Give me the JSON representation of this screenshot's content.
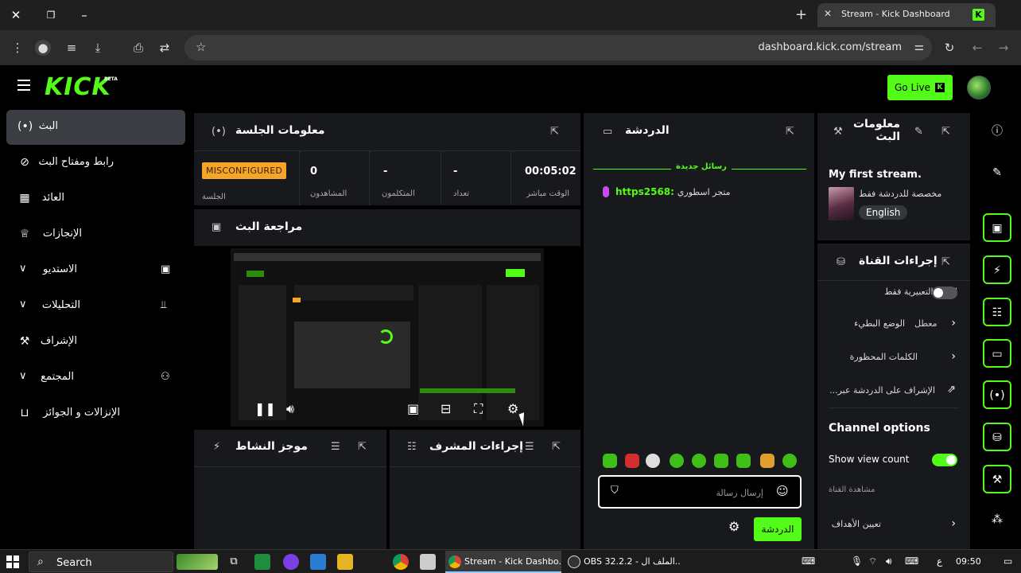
{
  "browser": {
    "tab_title": "Stream - Kick Dashboard",
    "tab_favicon": "K",
    "url": "dashboard.kick.com/stream"
  },
  "header": {
    "logo": "KICK",
    "beta": "BETA",
    "go_live": "Go Live",
    "go_live_icon": "K"
  },
  "sidebar": {
    "items": [
      {
        "label": "البث",
        "icon": "broadcast-icon"
      },
      {
        "label": "رابط ومفتاح البث",
        "icon": "link-icon"
      },
      {
        "label": "العائد",
        "icon": "revenue-icon"
      },
      {
        "label": "الإنجازات",
        "icon": "trophy-icon"
      },
      {
        "label": "الاستديو",
        "icon": "studio-icon"
      },
      {
        "label": "التحليلات",
        "icon": "analytics-icon"
      },
      {
        "label": "الإشراف",
        "icon": "wrench-icon"
      },
      {
        "label": "المجتمع",
        "icon": "community-icon"
      },
      {
        "label": "الإنزالات و الجوائز",
        "icon": "drops-icon"
      }
    ]
  },
  "session": {
    "title": "معلومات الجلسة",
    "badge": "MISCONFIGURED",
    "badge_label": "الجلسة",
    "viewers_value": "0",
    "viewers_label": "المشاهدون",
    "talkers_value": "-",
    "talkers_label": "المتكلمون",
    "count_value": "-",
    "count_label": "تعداد",
    "live_value": "00:05:02",
    "live_label": "الوقت مباشر"
  },
  "preview": {
    "title": "مراجعة البث"
  },
  "activity": {
    "title": "موجز النشاط"
  },
  "mod_actions": {
    "title": "إجراءات المشرف"
  },
  "chat": {
    "title": "الدردشة",
    "new_messages": "رسائل جديدة",
    "message_user": "https2568:",
    "message_text": "متجر اسطوري",
    "input_placeholder": "إرسال رسالة",
    "send_label": "الدردشة"
  },
  "stream_info": {
    "title": "معلومات البث",
    "stream_title": "My first stream.",
    "category": "مخصصة للدردشة فقط",
    "language": "English"
  },
  "channel_actions": {
    "title": "إجراءات القناة",
    "row_emotes": "الصور التعبيرية فقط",
    "row_slow_mode": "الوضع البطيء",
    "row_slow_value": "معطل",
    "row_banned_words": "الكلمات المحظورة",
    "row_moderate": "الإشراف على الدردشة عبر...",
    "options_title": "Channel options",
    "show_view_count": "Show view count",
    "viewers_sub": "مشاهدة القناة",
    "set_goals": "تعيين الأهداف"
  },
  "taskbar": {
    "search": "Search",
    "win_chrome": "Stream - Kick Dashbo...",
    "win_obs": "OBS 32.2.2 - الملف ال...",
    "lang": "ع",
    "time": "09:50"
  }
}
